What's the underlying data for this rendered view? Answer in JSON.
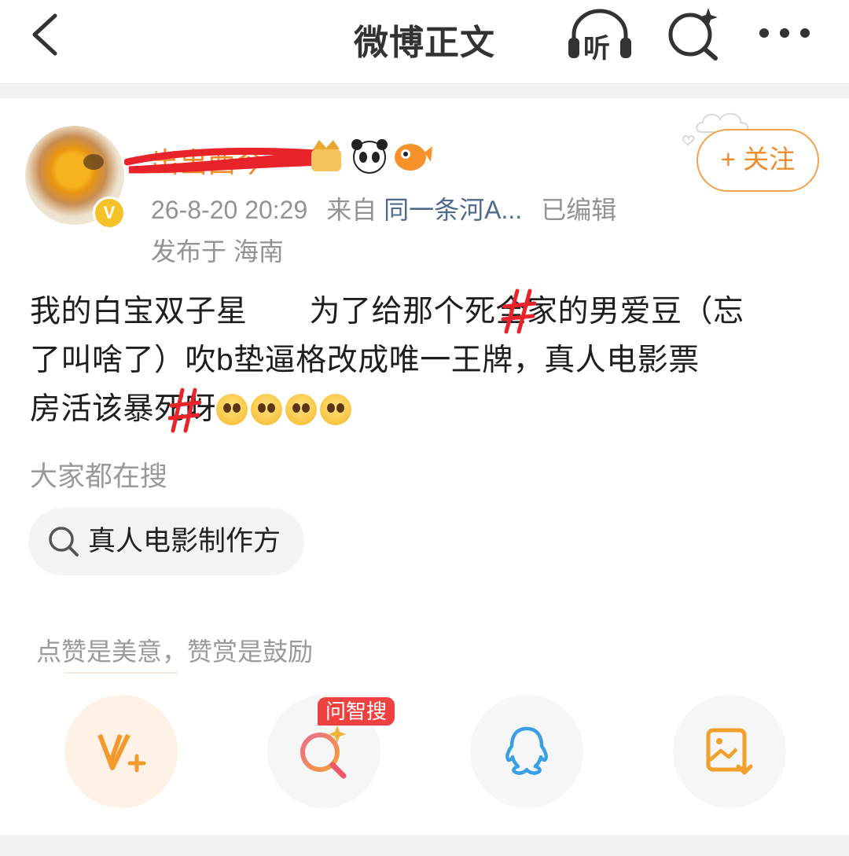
{
  "header": {
    "title": "微博正文",
    "listen_label": "听"
  },
  "author": {
    "name": "出出西今",
    "verified_mark": "V",
    "timestamp": "26-8-20 20:29",
    "source_prefix": "来自",
    "source": "同一条河A...",
    "edited": "已编辑",
    "location_prefix": "发布于",
    "location": "海南",
    "follow_label": "+ 关注"
  },
  "post": {
    "line1": "我的白宝双子星　　为了给那个死全家的男爱豆（忘",
    "line2": "了叫啥了）吹b垫逼格改成唯一王牌，真人电影票",
    "line3": "房活该暴死呀"
  },
  "search": {
    "heading": "大家都在搜",
    "chip_label": "真人电影制作方"
  },
  "reward": {
    "tip": "点赞是美意，赞赏是鼓励",
    "ai_badge": "问智搜"
  },
  "icons": [
    "back-arrow-icon",
    "headphones-icon",
    "ai-search-icon",
    "more-dots-icon",
    "search-icon",
    "panda-icon",
    "fish-icon",
    "crown-icon",
    "v-plus-icon",
    "qq-icon",
    "save-image-icon",
    "pleading-emoji-icon"
  ],
  "colors": {
    "accent_orange": "#f08b2a",
    "link_blue": "#4e6a8c",
    "badge_red": "#f04141",
    "qq_blue": "#3aa0e6"
  }
}
